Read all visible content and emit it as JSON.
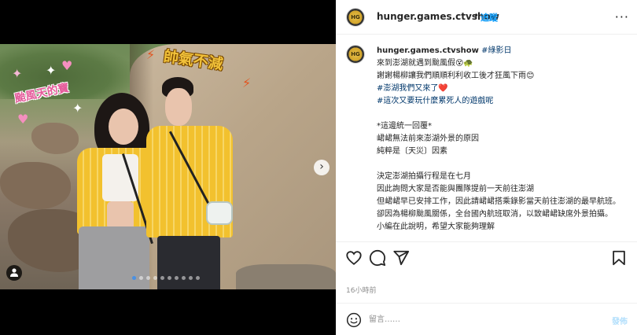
{
  "photo": {
    "stickers": {
      "top_right": "帥氣不減",
      "left": "颱風天的寶"
    },
    "carousel": {
      "total": 10,
      "active_index": 0
    }
  },
  "header": {
    "username": "hunger.games.ctvshow",
    "separator": "•",
    "follow_label": "追蹤",
    "more_label": "···"
  },
  "caption": {
    "username": "hunger.games.ctvshow",
    "first_tag": "#綠影日",
    "lines": [
      "來到澎湖就遇到颱風假😵🐢",
      "謝謝楊柳讓我們順順利利收工後才狂風下雨😊",
      "#澎湖我們又來了❤️",
      "#這次又要玩什麼累死人的遊戲呢",
      "",
      "*這邊統一回覆*",
      "峮峮無法前來澎湖外景的原因",
      "純粹是〔天災〕因素",
      "",
      "決定澎湖拍攝行程是在七月",
      "因此詢問大家是否能與團隊提前一天前往澎湖",
      "但峮峮早已安排工作，因此請峮峮搭乘錄影當天前往澎湖的最早航班。",
      "卻因為楊柳颱風關係，全台國內航班取消，以致峮峮缺席外景拍攝。",
      "小編在此說明，希望大家能夠理解"
    ]
  },
  "actions": {
    "like_icon": "heart-icon",
    "comment_icon": "comment-icon",
    "share_icon": "share-icon",
    "save_icon": "bookmark-icon"
  },
  "timestamp": "16小時前",
  "comment": {
    "placeholder": "留言……",
    "post_label": "發佈"
  },
  "colors": {
    "link_blue": "#0095f6",
    "hashtag": "#00376b",
    "post_disabled": "#b2dffc"
  }
}
